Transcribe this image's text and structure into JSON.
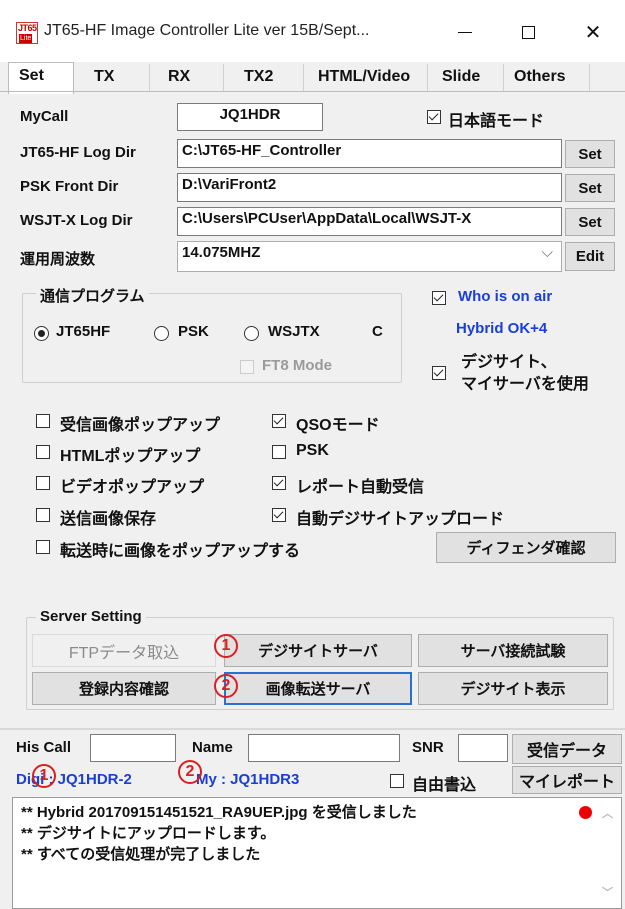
{
  "window": {
    "icon_text_top": "JT65",
    "icon_text_bottom": "Lite",
    "title": "JT65-HF Image Controller Lite ver 15B/Sept...",
    "min_glyph": "",
    "close_glyph": "✕"
  },
  "tabs": [
    "Set",
    "TX",
    "RX",
    "TX2",
    "HTML/Video",
    "Slide",
    "Others"
  ],
  "mycall": {
    "label": "MyCall",
    "value": "JQ1HDR"
  },
  "japanese_mode": {
    "label": "日本語モード",
    "checked": true
  },
  "dirs": [
    {
      "label": "JT65-HF Log Dir",
      "value": "C:\\JT65-HF_Controller",
      "button": "Set"
    },
    {
      "label": "PSK Front Dir",
      "value": "D:\\VariFront2",
      "button": "Set"
    },
    {
      "label": "WSJT-X Log Dir",
      "value": "C:\\Users\\PCUser\\AppData\\Local\\WSJT-X",
      "button": "Set"
    }
  ],
  "frequency": {
    "label": "運用周波数",
    "value": "14.075MHZ",
    "arrow": "⌵",
    "button": "Edit"
  },
  "comm_program": {
    "title": "通信プログラム",
    "options": [
      "JT65HF",
      "PSK",
      "WSJTX"
    ],
    "selected": "JT65HF",
    "c_label": "C",
    "ft8_mode": "FT8 Mode"
  },
  "right_opts": {
    "who_is_on_air": "Who is on air",
    "hybrid": "Hybrid OK+4",
    "digisite_line1": "デジサイト、",
    "digisite_line2": "マイサーバを使用"
  },
  "checks_left": [
    {
      "label": "受信画像ポップアップ",
      "checked": false
    },
    {
      "label": "HTMLポップアップ",
      "checked": false
    },
    {
      "label": "ビデオポップアップ",
      "checked": false
    },
    {
      "label": "送信画像保存",
      "checked": false
    },
    {
      "label": "転送時に画像をポップアップする",
      "checked": false
    }
  ],
  "checks_right": [
    {
      "label": "QSOモード",
      "checked": true
    },
    {
      "label": "PSK",
      "checked": false
    },
    {
      "label": "レポート自動受信",
      "checked": true
    },
    {
      "label": "自動デジサイトアップロード",
      "checked": true
    }
  ],
  "defender_button": "ディフェンダ確認",
  "server": {
    "title": "Server Setting",
    "ftp": "FTPデータ取込",
    "digisite_server": "デジサイトサーバ",
    "conn_test": "サーバ接続試験",
    "reg_check": "登録内容確認",
    "image_server": "画像転送サーバ",
    "digisite_show": "デジサイト表示",
    "num1": "1",
    "num2": "2"
  },
  "bottom": {
    "his_call": "His Call",
    "name": "Name",
    "snr": "SNR",
    "recv_data": "受信データ",
    "digi": "Digi : JQ1HDR-2",
    "my": "My : JQ1HDR3",
    "free_write": "自由書込",
    "my_report": "マイレポート",
    "num1": "1",
    "num2": "2"
  },
  "log_lines": [
    "** Hybrid 201709151451521_RA9UEP.jpg を受信しました",
    "** デジサイトにアップロードします。",
    "** すべての受信処理が完了しました"
  ]
}
